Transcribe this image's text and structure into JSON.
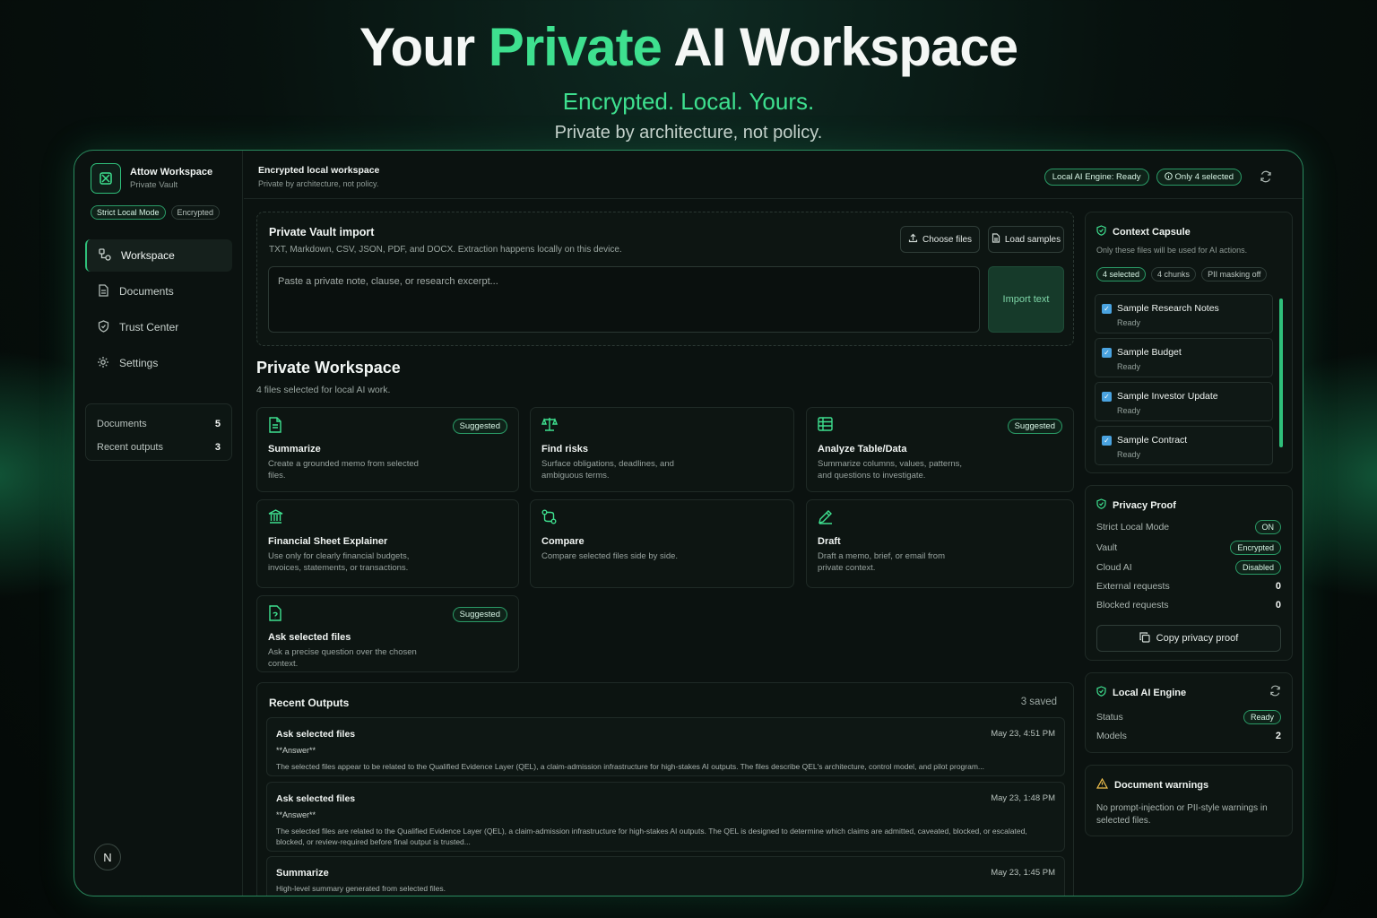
{
  "hero": {
    "title_pre": "Your ",
    "title_accent": "Private",
    "title_post": " AI Workspace",
    "tagline": "Encrypted. Local. Yours.",
    "sub": "Private by architecture, not policy."
  },
  "brand": {
    "name": "Attow Workspace",
    "sub": "Private Vault",
    "badges": [
      "Strict Local Mode",
      "Encrypted"
    ]
  },
  "nav": [
    {
      "label": "Workspace",
      "icon": "workspace-icon"
    },
    {
      "label": "Documents",
      "icon": "document-icon"
    },
    {
      "label": "Trust Center",
      "icon": "shield-icon"
    },
    {
      "label": "Settings",
      "icon": "gear-icon"
    }
  ],
  "sidebar_stats": [
    {
      "label": "Documents",
      "value": "5"
    },
    {
      "label": "Recent outputs",
      "value": "3"
    }
  ],
  "avatar": "N",
  "topbar": {
    "title": "Encrypted local workspace",
    "sub": "Private by architecture, not policy.",
    "engine_status": "Local AI Engine: Ready",
    "selection": "Only 4 selected"
  },
  "import": {
    "title": "Private Vault import",
    "desc": "TXT, Markdown, CSV, JSON, PDF, and DOCX. Extraction happens locally on this device.",
    "choose_label": "Choose files",
    "load_label": "Load samples",
    "placeholder": "Paste a private note, clause, or research excerpt...",
    "import_label": "Import text"
  },
  "workspace": {
    "title": "Private Workspace",
    "sub": "4 files selected for local AI work.",
    "tiles": [
      {
        "title": "Summarize",
        "desc": "Create a grounded memo from selected files.",
        "badge": "Suggested",
        "icon": "document-icon"
      },
      {
        "title": "Find risks",
        "desc": "Surface obligations, deadlines, and ambiguous terms.",
        "badge": "",
        "icon": "scale-icon"
      },
      {
        "title": "Analyze Table/Data",
        "desc": "Summarize columns, values, patterns, and questions to investigate.",
        "badge": "Suggested",
        "icon": "table-icon"
      },
      {
        "title": "Financial Sheet Explainer",
        "desc": "Use only for clearly financial budgets, invoices, statements, or transactions.",
        "badge": "",
        "icon": "bank-icon"
      },
      {
        "title": "Compare",
        "desc": "Compare selected files side by side.",
        "badge": "",
        "icon": "compare-icon"
      },
      {
        "title": "Draft",
        "desc": "Draft a memo, brief, or email from private context.",
        "badge": "",
        "icon": "pen-icon"
      },
      {
        "title": "Ask selected files",
        "desc": "Ask a precise question over the chosen context.",
        "badge": "Suggested",
        "icon": "file-question-icon"
      }
    ]
  },
  "outputs": {
    "title": "Recent Outputs",
    "count": "3 saved",
    "items": [
      {
        "title": "Ask selected files",
        "time": "May 23, 4:51 PM",
        "md": "**Answer**",
        "body": "The selected files appear to be related to the Qualified Evidence Layer (QEL), a claim-admission infrastructure for high-stakes AI outputs. The files describe QEL's architecture, control model, and pilot program..."
      },
      {
        "title": "Ask selected files",
        "time": "May 23, 1:48 PM",
        "md": "**Answer**",
        "body": "The selected files are related to the Qualified Evidence Layer (QEL), a claim-admission infrastructure for high-stakes AI outputs. The QEL is designed to determine which claims are admitted, caveated, blocked, or escalated, blocked, or review-required before final output is trusted..."
      },
      {
        "title": "Summarize",
        "time": "May 23, 1:45 PM",
        "md": "",
        "body": "High-level summary generated from selected files."
      }
    ]
  },
  "capsule": {
    "title": "Context Capsule",
    "sub": "Only these files will be used for AI actions.",
    "pills": [
      "4 selected",
      "4 chunks",
      "PII masking off"
    ],
    "files": [
      {
        "name": "Sample Research Notes",
        "status": "Ready"
      },
      {
        "name": "Sample Budget",
        "status": "Ready"
      },
      {
        "name": "Sample Investor Update",
        "status": "Ready"
      },
      {
        "name": "Sample Contract",
        "status": "Ready"
      }
    ]
  },
  "privacy": {
    "title": "Privacy Proof",
    "rows": [
      {
        "label": "Strict Local Mode",
        "value": "ON",
        "kind": "pill"
      },
      {
        "label": "Vault",
        "value": "Encrypted",
        "kind": "pill"
      },
      {
        "label": "Cloud AI",
        "value": "Disabled",
        "kind": "pill"
      },
      {
        "label": "External requests",
        "value": "0",
        "kind": "num"
      },
      {
        "label": "Blocked requests",
        "value": "0",
        "kind": "num"
      }
    ],
    "copy_label": "Copy privacy proof"
  },
  "engine": {
    "title": "Local AI Engine",
    "rows": [
      {
        "label": "Status",
        "value": "Ready",
        "kind": "pill"
      },
      {
        "label": "Models",
        "value": "2",
        "kind": "num"
      }
    ]
  },
  "warnings": {
    "title": "Document warnings",
    "body": "No prompt-injection or PII-style warnings in selected files."
  },
  "colors": {
    "accent": "#3ee08f",
    "background": "#0b1210",
    "border_glow": "#2a8a5e",
    "warning": "#f2c14e",
    "checkbox": "#4aa3e0"
  }
}
